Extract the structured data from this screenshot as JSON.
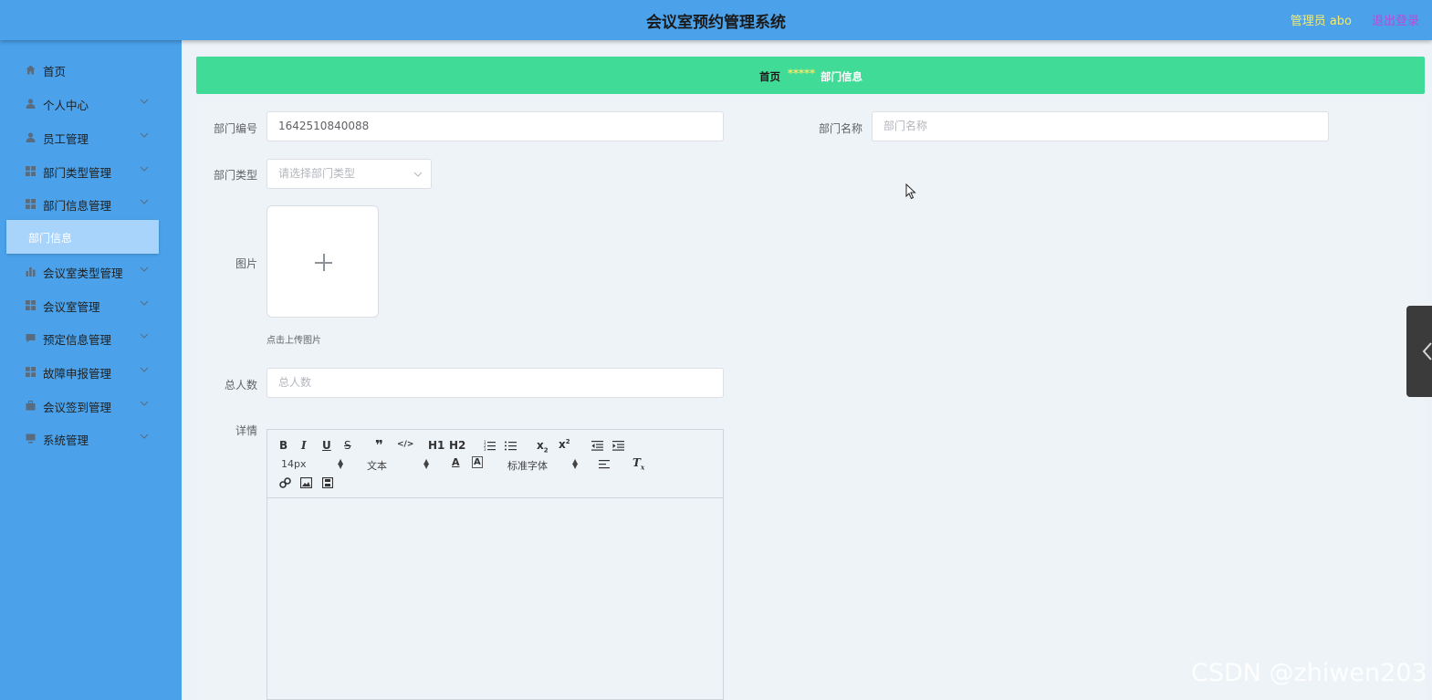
{
  "header": {
    "title": "会议室预约管理系统",
    "user_label": "管理员 abo",
    "logout_label": "退出登录"
  },
  "sidebar": {
    "items": [
      {
        "label": "首页",
        "icon": "home-icon"
      },
      {
        "label": "个人中心",
        "icon": "user-icon"
      },
      {
        "label": "员工管理",
        "icon": "user-icon"
      },
      {
        "label": "部门类型管理",
        "icon": "grid-icon"
      },
      {
        "label": "部门信息管理",
        "icon": "grid-icon"
      },
      {
        "label": "会议室类型管理",
        "icon": "bar-chart-icon"
      },
      {
        "label": "会议室管理",
        "icon": "grid-icon"
      },
      {
        "label": "预定信息管理",
        "icon": "message-icon"
      },
      {
        "label": "故障申报管理",
        "icon": "grid-icon"
      },
      {
        "label": "会议签到管理",
        "icon": "briefcase-icon"
      },
      {
        "label": "系统管理",
        "icon": "monitor-icon"
      }
    ],
    "active_sub": "部门信息"
  },
  "breadcrumb": {
    "home": "首页",
    "separator": "*****",
    "current": "部门信息"
  },
  "form": {
    "dept_no_label": "部门编号",
    "dept_no_value": "1642510840088",
    "dept_name_label": "部门名称",
    "dept_name_placeholder": "部门名称",
    "dept_type_label": "部门类型",
    "dept_type_placeholder": "请选择部门类型",
    "image_label": "图片",
    "upload_tip": "点击上传图片",
    "total_label": "总人数",
    "total_placeholder": "总人数",
    "detail_label": "详情"
  },
  "editor": {
    "font_size": "14px",
    "header_select": "文本",
    "font_family": "标准字体",
    "h1": "H1",
    "h2": "H2"
  },
  "watermark": "CSDN @zhiwen203",
  "colors": {
    "header_bg": "#4ba2ea",
    "breadcrumb_bg": "#40db97",
    "accent_yellow": "#f5e96b",
    "logout_purple": "#b04fd8"
  }
}
